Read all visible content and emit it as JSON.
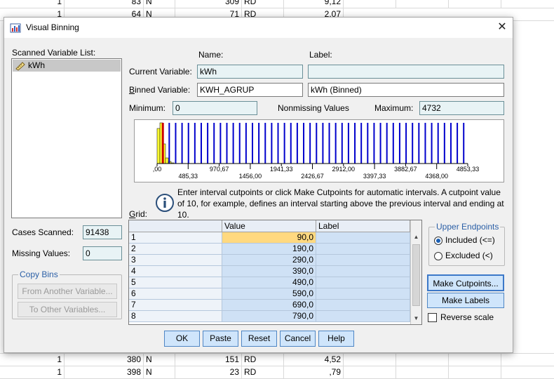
{
  "background_rows": {
    "top": [
      {
        "col1": "1",
        "col2": "83",
        "col3": "N",
        "col4": "309",
        "col5": "RD",
        "col6": "9,12"
      },
      {
        "col1": "1",
        "col2": "64",
        "col3": "N",
        "col4": "71",
        "col5": "RD",
        "col6": "2,07"
      }
    ],
    "bottom": [
      {
        "col1": "1",
        "col2": "380",
        "col3": "N",
        "col4": "151",
        "col5": "RD",
        "col6": "4,52"
      },
      {
        "col1": "1",
        "col2": "398",
        "col3": "N",
        "col4": "23",
        "col5": "RD",
        "col6": ",79"
      }
    ]
  },
  "dialog": {
    "title": "Visual Binning",
    "close_glyph": "✕",
    "scanned_list": {
      "label": "Scanned Variable List:",
      "items": [
        {
          "name": "kWh",
          "icon": "ruler-icon"
        }
      ]
    },
    "name_header": "Name:",
    "label_header": "Label:",
    "current_variable": {
      "label": "Current Variable:",
      "name": "kWh",
      "label_value": ""
    },
    "binned_variable": {
      "label": "Binned Variable:",
      "name": "KWH_AGRUP",
      "label_value": "kWh (Binned)"
    },
    "minimum": {
      "label": "Minimum:",
      "value": "0"
    },
    "nonmissing": {
      "label": "Nonmissing Values"
    },
    "maximum": {
      "label": "Maximum:",
      "value": "4732"
    },
    "histogram": {
      "ticks_top": [
        ",00",
        "970,67",
        "1941,33",
        "2912,00",
        "3882,67",
        "4853,33"
      ],
      "ticks_bottom": [
        "485,33",
        "1456,00",
        "2426,67",
        "3397,33",
        "4368,00"
      ],
      "bar_color": "#ffff33",
      "cutpoint_color": "#0000cc",
      "selected_cutpoint_color": "#cc0000"
    },
    "info_text": "Enter interval cutpoints or click Make Cutpoints for automatic intervals. A cutpoint value of 10, for example, defines an interval starting above the previous interval and ending at 10.",
    "grid": {
      "label": "Grid:",
      "headers": [
        "",
        "Value",
        "Label"
      ],
      "rows": [
        {
          "num": "1",
          "value": "90,0",
          "label": ""
        },
        {
          "num": "2",
          "value": "190,0",
          "label": ""
        },
        {
          "num": "3",
          "value": "290,0",
          "label": ""
        },
        {
          "num": "4",
          "value": "390,0",
          "label": ""
        },
        {
          "num": "5",
          "value": "490,0",
          "label": ""
        },
        {
          "num": "6",
          "value": "590,0",
          "label": ""
        },
        {
          "num": "7",
          "value": "690,0",
          "label": ""
        },
        {
          "num": "8",
          "value": "790,0",
          "label": ""
        }
      ]
    },
    "cases_scanned": {
      "label": "Cases Scanned:",
      "value": "91438"
    },
    "missing_values": {
      "label": "Missing Values:",
      "value": "0"
    },
    "copy_bins": {
      "title": "Copy Bins",
      "from_another": "From Another Variable...",
      "to_other": "To Other Variables..."
    },
    "upper_endpoints": {
      "title": "Upper Endpoints",
      "included": "Included (<=)",
      "excluded": "Excluded (<)",
      "selected": "included"
    },
    "make_cutpoints": "Make Cutpoints...",
    "make_labels": "Make Labels",
    "reverse_scale": {
      "label": "Reverse scale",
      "checked": false
    },
    "buttons": {
      "ok": "OK",
      "paste": "Paste",
      "reset": "Reset",
      "cancel": "Cancel",
      "help": "Help"
    }
  }
}
